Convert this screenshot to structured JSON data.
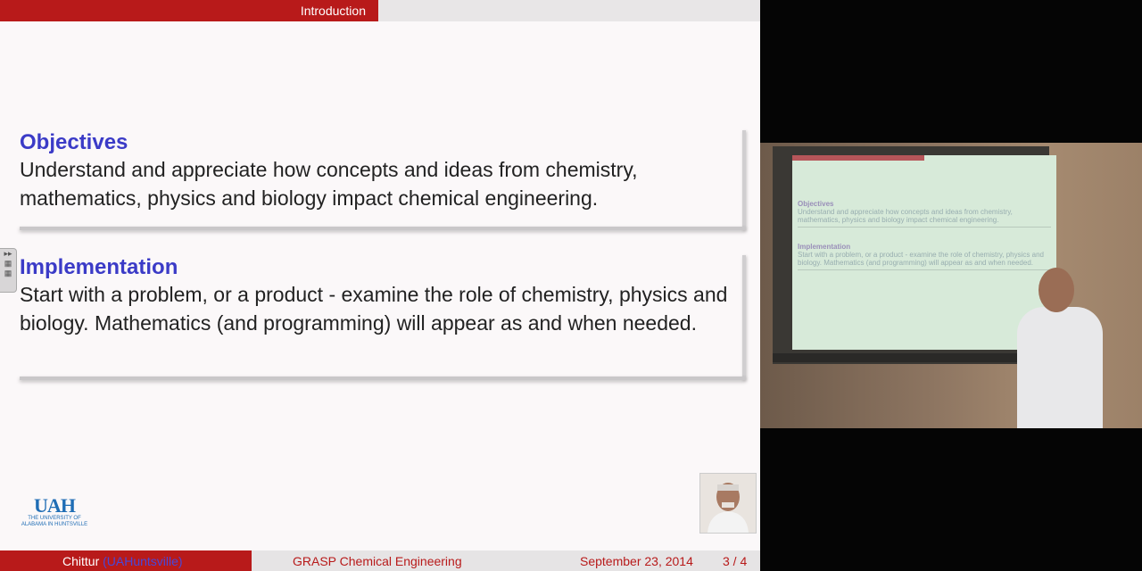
{
  "slide": {
    "section_label": "Introduction",
    "blocks": [
      {
        "title": "Objectives",
        "body": "Understand and appreciate how concepts and ideas from chemistry, mathematics, physics and biology impact chemical engineering."
      },
      {
        "title": "Implementation",
        "body": "Start with a problem, or a product - examine the role of chemistry, physics and biology. Mathematics (and programming) will appear as and when needed."
      }
    ],
    "logo": {
      "mark": "UAH",
      "subtitle": "THE UNIVERSITY OF ALABAMA IN HUNTSVILLE"
    },
    "footer": {
      "author": "Chittur",
      "institution": "(UAHuntsville)",
      "course": "GRASP Chemical Engineering",
      "date": "September 23, 2014",
      "page": "3 / 4"
    }
  },
  "video": {
    "mini_slide": {
      "t1": "Objectives",
      "b1": "Understand and appreciate how concepts and ideas from chemistry, mathematics, physics and biology impact chemical engineering.",
      "t2": "Implementation",
      "b2": "Start with a problem, or a product - examine the role of chemistry, physics and biology. Mathematics (and programming) will appear as and when needed."
    }
  },
  "colors": {
    "accent": "#b81a1a",
    "title_blue": "#3b3bc7",
    "logo_blue": "#1f6db5"
  }
}
